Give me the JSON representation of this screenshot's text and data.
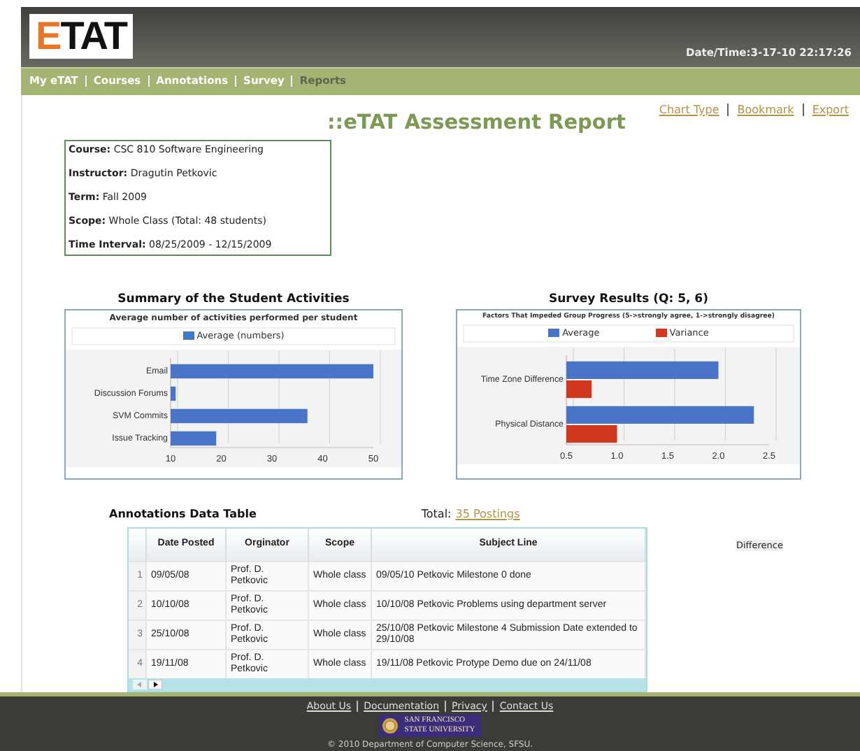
{
  "header": {
    "logo": "ETAT",
    "datetime": "Date/Time:3-17-10 22:17:26"
  },
  "nav": [
    {
      "label": "My eTAT",
      "selected": false
    },
    {
      "label": "Courses",
      "selected": false
    },
    {
      "label": "Annotations",
      "selected": false
    },
    {
      "label": "Survey",
      "selected": false
    },
    {
      "label": "Reports",
      "selected": true
    }
  ],
  "page_title": "::eTAT Assessment Report",
  "actions": [
    "Chart Type",
    "Bookmark",
    "Export"
  ],
  "info": [
    {
      "label": "Course:",
      "value": "CSC 810 Software Engineering"
    },
    {
      "label": "Instructor:",
      "value": "Dragutin Petkovic"
    },
    {
      "label": "Term:",
      "value": "Fall 2009"
    },
    {
      "label": "Scope:",
      "value": "Whole Class (Total: 48 students)"
    },
    {
      "label": "Time Interval:",
      "value": "08/25/2009 - 12/15/2009"
    }
  ],
  "charts": [
    {
      "heading": "Summary of the Student Activities",
      "chart_data": {
        "type": "bar",
        "orientation": "horizontal",
        "legend": "top",
        "title": "Average number of activities performed per student",
        "categories": [
          "Email",
          "Discussion Forums",
          "SVM Commits",
          "Issue Tracking"
        ],
        "series": [
          {
            "name": "Average (numbers)",
            "color": "#4a74c6",
            "values": [
              50,
              11,
              37,
              19
            ]
          }
        ],
        "xlim": [
          10,
          50
        ],
        "xticks": [
          10,
          20,
          30,
          40,
          50
        ]
      }
    },
    {
      "heading": "**Survey Results** (Q: 5, 6)",
      "chart_data": {
        "type": "bar",
        "orientation": "horizontal",
        "legend": "top",
        "title": "Factors That Impeded Group Progress (5->strongly agree, 1->strongly disagree)",
        "categories": [
          "Time Zone Difference",
          "Physical Distance"
        ],
        "series": [
          {
            "name": "Average",
            "color": "#4a74c6",
            "values": [
              2.0,
              2.35
            ]
          },
          {
            "name": "Variance",
            "color": "#d2381f",
            "values": [
              0.75,
              1.0
            ]
          }
        ],
        "xlim": [
          0.5,
          2.5
        ],
        "xticks": [
          {
            "value": 0.5,
            "label": "0.5"
          },
          {
            "value": 1,
            "label": "1.0"
          },
          {
            "value": 1.5,
            "label": "1.5"
          },
          {
            "value": 2,
            "label": "2.0"
          },
          {
            "value": 2.5,
            "label": "2.5"
          }
        ]
      }
    }
  ],
  "annotations": {
    "heading": "Annotations Data Table",
    "total_label": "Total:",
    "total_link": "35 Postings",
    "side_label": "Difference",
    "columns": [
      "Date Posted",
      "Orginator",
      "Scope",
      "Subject Line"
    ],
    "rows": [
      {
        "index": "1",
        "cells": [
          "09/05/08",
          "Prof. D. Petkovic",
          "Whole class",
          "09/05/10 Petkovic Milestone 0 done"
        ]
      },
      {
        "index": "2",
        "cells": [
          "10/10/08",
          "Prof. D. Petkovic",
          "Whole class",
          "10/10/08 Petkovic Problems using department server"
        ]
      },
      {
        "index": "3",
        "cells": [
          "25/10/08",
          "Prof. D. Petkovic",
          "Whole class",
          "25/10/08 Petkovic Milestone 4 Submission Date extended to 29/10/08"
        ]
      },
      {
        "index": "4",
        "cells": [
          "19/11/08",
          "Prof. D. Petkovic",
          "Whole class",
          "19/11/08 Petkovic Protype Demo due on 24/11/08"
        ]
      }
    ]
  },
  "footer": {
    "links": [
      "About Us",
      "Documentation",
      "Privacy",
      "Contact Us"
    ],
    "logo_lines": [
      "SAN FRANCISCO",
      "STATE UNIVERSITY"
    ],
    "copyright": "© 2010 Department of Computer Science, SFSU."
  }
}
